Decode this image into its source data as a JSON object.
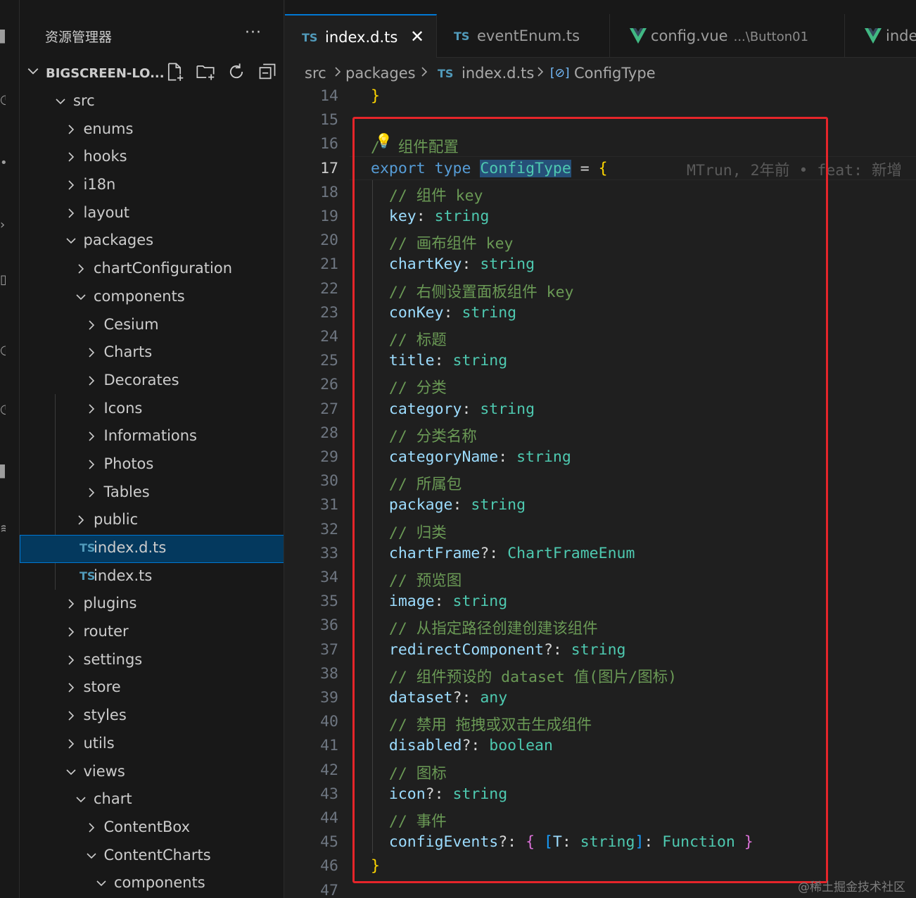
{
  "explorer": {
    "title": "资源管理器",
    "more_label": "···",
    "root_label": "BIGSCREEN-LO...",
    "actions": [
      "new-file-icon",
      "new-folder-icon",
      "refresh-icon",
      "collapse-all-icon"
    ]
  },
  "tree": [
    {
      "label": "src",
      "depth": 0,
      "expanded": true
    },
    {
      "label": "enums",
      "depth": 1,
      "expanded": false
    },
    {
      "label": "hooks",
      "depth": 1,
      "expanded": false
    },
    {
      "label": "i18n",
      "depth": 1,
      "expanded": false
    },
    {
      "label": "layout",
      "depth": 1,
      "expanded": false
    },
    {
      "label": "packages",
      "depth": 1,
      "expanded": true
    },
    {
      "label": "chartConfiguration",
      "depth": 2,
      "expanded": false
    },
    {
      "label": "components",
      "depth": 2,
      "expanded": true
    },
    {
      "label": "Cesium",
      "depth": 3,
      "expanded": false
    },
    {
      "label": "Charts",
      "depth": 3,
      "expanded": false
    },
    {
      "label": "Decorates",
      "depth": 3,
      "expanded": false
    },
    {
      "label": "Icons",
      "depth": 3,
      "expanded": false
    },
    {
      "label": "Informations",
      "depth": 3,
      "expanded": false
    },
    {
      "label": "Photos",
      "depth": 3,
      "expanded": false
    },
    {
      "label": "Tables",
      "depth": 3,
      "expanded": false
    },
    {
      "label": "public",
      "depth": 2,
      "expanded": false
    },
    {
      "label": "index.d.ts",
      "depth": 2,
      "file": true,
      "badge": "TS",
      "selected": true
    },
    {
      "label": "index.ts",
      "depth": 2,
      "file": true,
      "badge": "TS"
    },
    {
      "label": "plugins",
      "depth": 1,
      "expanded": false
    },
    {
      "label": "router",
      "depth": 1,
      "expanded": false
    },
    {
      "label": "settings",
      "depth": 1,
      "expanded": false
    },
    {
      "label": "store",
      "depth": 1,
      "expanded": false
    },
    {
      "label": "styles",
      "depth": 1,
      "expanded": false
    },
    {
      "label": "utils",
      "depth": 1,
      "expanded": false
    },
    {
      "label": "views",
      "depth": 1,
      "expanded": true
    },
    {
      "label": "chart",
      "depth": 2,
      "expanded": true
    },
    {
      "label": "ContentBox",
      "depth": 3,
      "expanded": false
    },
    {
      "label": "ContentCharts",
      "depth": 3,
      "expanded": true
    },
    {
      "label": "components",
      "depth": 4,
      "expanded": true
    }
  ],
  "tabs": [
    {
      "badge": "TS",
      "label": "index.d.ts",
      "active": true,
      "close": "✕"
    },
    {
      "badge": "TS",
      "label": "eventEnum.ts"
    },
    {
      "badge": "vue-icon",
      "label": "config.vue",
      "desc": "...\\Button01"
    },
    {
      "badge": "vue-icon",
      "label": "inde"
    }
  ],
  "breadcrumb": {
    "items": [
      "src",
      "packages"
    ],
    "file_badge": "TS",
    "file": "index.d.ts",
    "symbol_icon": "[⊘]",
    "symbol": "ConfigType"
  },
  "editor": {
    "first_line": 14,
    "current_line": 17,
    "blame": "MTrun, 2年前 • feat: 新增",
    "lines": [
      [
        [
          "}",
          "k-brace"
        ]
      ],
      [],
      [
        [
          "/",
          "k-comment"
        ],
        [
          "  组件配置",
          "k-comment"
        ]
      ],
      [
        [
          "export",
          "k-kw"
        ],
        [
          " ",
          ""
        ],
        [
          "type",
          "k-kw"
        ],
        [
          " ",
          ""
        ],
        [
          "ConfigType",
          "k-type hl-word"
        ],
        [
          " = ",
          "k-punc"
        ],
        [
          "{",
          "k-brace"
        ]
      ],
      [
        [
          "  // 组件 key",
          "k-comment"
        ]
      ],
      [
        [
          "  key",
          "k-prop"
        ],
        [
          ": ",
          "k-punc"
        ],
        [
          "string",
          "k-type"
        ]
      ],
      [
        [
          "  // 画布组件 key",
          "k-comment"
        ]
      ],
      [
        [
          "  chartKey",
          "k-prop"
        ],
        [
          ": ",
          "k-punc"
        ],
        [
          "string",
          "k-type"
        ]
      ],
      [
        [
          "  // 右侧设置面板组件 key",
          "k-comment"
        ]
      ],
      [
        [
          "  conKey",
          "k-prop"
        ],
        [
          ": ",
          "k-punc"
        ],
        [
          "string",
          "k-type"
        ]
      ],
      [
        [
          "  // 标题",
          "k-comment"
        ]
      ],
      [
        [
          "  title",
          "k-prop"
        ],
        [
          ": ",
          "k-punc"
        ],
        [
          "string",
          "k-type"
        ]
      ],
      [
        [
          "  // 分类",
          "k-comment"
        ]
      ],
      [
        [
          "  category",
          "k-prop"
        ],
        [
          ": ",
          "k-punc"
        ],
        [
          "string",
          "k-type"
        ]
      ],
      [
        [
          "  // 分类名称",
          "k-comment"
        ]
      ],
      [
        [
          "  categoryName",
          "k-prop"
        ],
        [
          ": ",
          "k-punc"
        ],
        [
          "string",
          "k-type"
        ]
      ],
      [
        [
          "  // 所属包",
          "k-comment"
        ]
      ],
      [
        [
          "  package",
          "k-prop"
        ],
        [
          ": ",
          "k-punc"
        ],
        [
          "string",
          "k-type"
        ]
      ],
      [
        [
          "  // 归类",
          "k-comment"
        ]
      ],
      [
        [
          "  chartFrame",
          "k-prop"
        ],
        [
          "?: ",
          "k-punc"
        ],
        [
          "ChartFrameEnum",
          "k-type"
        ]
      ],
      [
        [
          "  // 预览图",
          "k-comment"
        ]
      ],
      [
        [
          "  image",
          "k-prop"
        ],
        [
          ": ",
          "k-punc"
        ],
        [
          "string",
          "k-type"
        ]
      ],
      [
        [
          "  // 从指定路径创建创建该组件",
          "k-comment"
        ]
      ],
      [
        [
          "  redirectComponent",
          "k-prop"
        ],
        [
          "?: ",
          "k-punc"
        ],
        [
          "string",
          "k-type"
        ]
      ],
      [
        [
          "  // 组件预设的 dataset 值(图片/图标)",
          "k-comment"
        ]
      ],
      [
        [
          "  dataset",
          "k-prop"
        ],
        [
          "?: ",
          "k-punc"
        ],
        [
          "any",
          "k-type"
        ]
      ],
      [
        [
          "  // 禁用 拖拽或双击生成组件",
          "k-comment"
        ]
      ],
      [
        [
          "  disabled",
          "k-prop"
        ],
        [
          "?: ",
          "k-punc"
        ],
        [
          "boolean",
          "k-type"
        ]
      ],
      [
        [
          "  // 图标",
          "k-comment"
        ]
      ],
      [
        [
          "  icon",
          "k-prop"
        ],
        [
          "?: ",
          "k-punc"
        ],
        [
          "string",
          "k-type"
        ]
      ],
      [
        [
          "  // 事件",
          "k-comment"
        ]
      ],
      [
        [
          "  configEvents",
          "k-prop"
        ],
        [
          "?: ",
          "k-punc"
        ],
        [
          "{",
          "k-brace2"
        ],
        [
          " ",
          ""
        ],
        [
          "[",
          "k-brace3"
        ],
        [
          "T",
          "k-prop"
        ],
        [
          ": ",
          "k-punc"
        ],
        [
          "string",
          "k-type"
        ],
        [
          "]",
          "k-brace3"
        ],
        [
          ": ",
          "k-punc"
        ],
        [
          "Function",
          "k-type"
        ],
        [
          " ",
          ""
        ],
        [
          "}",
          "k-brace2"
        ]
      ],
      [
        [
          "}",
          "k-brace"
        ]
      ],
      []
    ]
  },
  "watermark": "@稀土掘金技术社区",
  "colors": {
    "accent": "#0078d4",
    "highlight_box": "#e5252a",
    "selection": "#04395e"
  }
}
